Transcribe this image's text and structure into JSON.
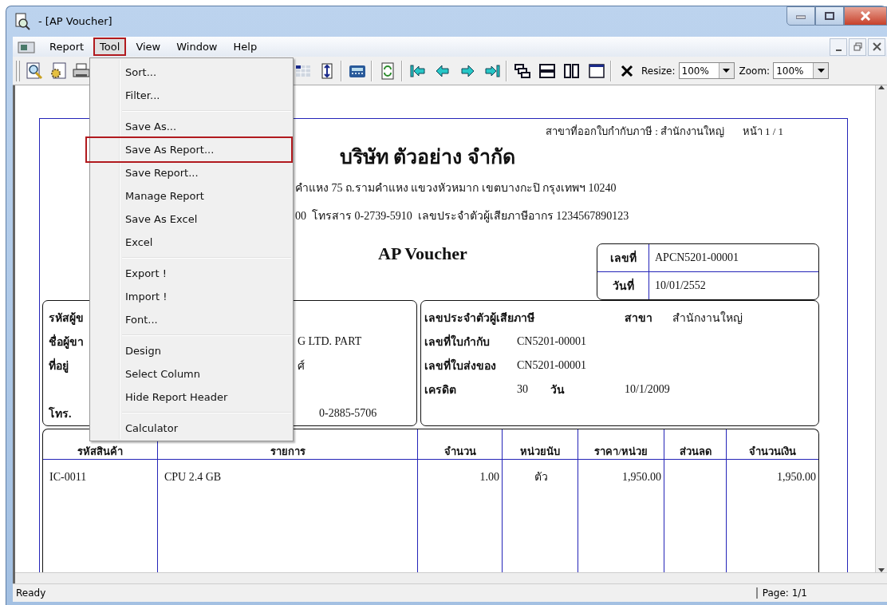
{
  "window": {
    "title": "- [AP Voucher]"
  },
  "menu_bar": [
    {
      "label": "Report",
      "selected": false
    },
    {
      "label": "Tool",
      "selected": true
    },
    {
      "label": "View",
      "selected": false
    },
    {
      "label": "Window",
      "selected": false
    },
    {
      "label": "Help",
      "selected": false
    }
  ],
  "toolbar": {
    "resize_label": "Resize:",
    "resize_value": "100%",
    "zoom_label": "Zoom:",
    "zoom_value": "100%"
  },
  "tool_menu": [
    {
      "kind": "item",
      "label": "Sort...",
      "selected": false
    },
    {
      "kind": "item",
      "label": "Filter...",
      "selected": false
    },
    {
      "kind": "separator"
    },
    {
      "kind": "item",
      "label": "Save As...",
      "selected": false
    },
    {
      "kind": "item",
      "label": "Save As Report...",
      "selected": true
    },
    {
      "kind": "item",
      "label": "Save Report...",
      "selected": false
    },
    {
      "kind": "item",
      "label": "Manage Report",
      "selected": false
    },
    {
      "kind": "item",
      "label": "Save As Excel",
      "selected": false
    },
    {
      "kind": "item",
      "label": "Excel",
      "selected": false
    },
    {
      "kind": "separator"
    },
    {
      "kind": "item",
      "label": "Export !",
      "selected": false
    },
    {
      "kind": "item",
      "label": "Import !",
      "selected": false
    },
    {
      "kind": "item",
      "label": "Font...",
      "selected": false
    },
    {
      "kind": "separator"
    },
    {
      "kind": "item",
      "label": "Design",
      "selected": false
    },
    {
      "kind": "item",
      "label": "Select Column",
      "selected": false
    },
    {
      "kind": "item",
      "label": "Hide Report Header",
      "selected": false
    },
    {
      "kind": "separator"
    },
    {
      "kind": "item",
      "label": "Calculator",
      "selected": false
    }
  ],
  "report": {
    "branch_line": "สาขาที่ออกใบกำกับภาษี : สำนักงานใหญ่",
    "page": "หน้า 1 / 1",
    "company": "บริษัท ตัวอย่าง จำกัด",
    "address": "คำแหง 75 ถ.รามคำแหง แขวงหัวหมาก เขตบางกะปิ กรุงเทพฯ 10240",
    "contact": "00  โทรสาร 0-2739-5910  เลขประจำตัวผู้เสียภาษีอากร 1234567890123",
    "doc_title": "AP Voucher",
    "doc_info": [
      {
        "label": "เลขที่",
        "value": "APCN5201-00001"
      },
      {
        "label": "วันที่",
        "value": "10/01/2552"
      }
    ],
    "vendor": [
      {
        "label": "รหัสผู้ข"
      },
      {
        "label": "ชื่อผู้ขา",
        "value": "G LTD. PART"
      },
      {
        "label": "ที่อยู่",
        "value": "ศ์"
      },
      {
        "label": "โทร.",
        "value": "0-2885-5706"
      }
    ],
    "tax": {
      "tax_id_label": "เลขประจำตัวผู้เสียภาษี",
      "branch_label": "สาขา",
      "branch": "สำนักงานใหญ่",
      "invoice_label": "เลขที่ใบกำกับ",
      "invoice": "CN5201-00001",
      "delivery_label": "เลขที่ใบส่งของ",
      "delivery": "CN5201-00001",
      "credit_label": "เครดิต",
      "credit_days": "30",
      "days_unit": "วัน",
      "due_date": "10/1/2009"
    },
    "table": {
      "columns": [
        "รหัสสินค้า",
        "รายการ",
        "จำนวน",
        "หน่วยนับ",
        "ราคา/หน่วย",
        "ส่วนลด",
        "จำนวนเงิน"
      ],
      "rows": [
        [
          "IC-0011",
          "CPU  2.4 GB",
          "1.00",
          "ตัว",
          "1,950.00",
          null,
          "1,950.00"
        ]
      ]
    }
  },
  "status_bar": {
    "message": "Ready",
    "page": "Page: 1/1"
  }
}
